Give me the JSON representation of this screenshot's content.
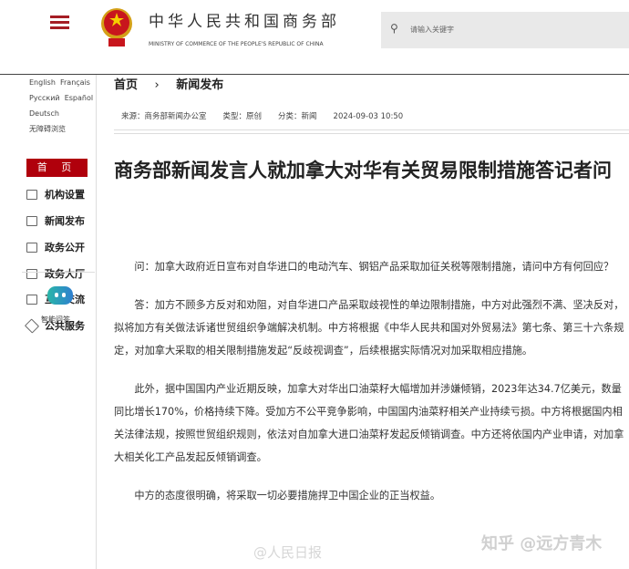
{
  "header": {
    "title_cn": "中华人民共和国商务部",
    "title_en": "MINISTRY OF COMMERCE OF THE PEOPLE'S REPUBLIC OF CHINA",
    "search_placeholder": "请输入关键字"
  },
  "sidebar": {
    "languages": [
      "English",
      "Français",
      "Русский",
      "Español",
      "Deutsch",
      "无障碍浏览"
    ],
    "home": "首 页",
    "items": [
      "机构设置",
      "新闻发布",
      "政务公开",
      "政务大厅",
      "互动交流",
      "公共服务"
    ],
    "assistant": "智能问答"
  },
  "breadcrumb": {
    "home": "首页",
    "sep": "›",
    "current": "新闻发布"
  },
  "meta": {
    "source": "来源：商务部新闻办公室",
    "type": "类型：原创",
    "category": "分类：新闻",
    "datetime": "2024-09-03 10:50"
  },
  "article": {
    "title": "商务部新闻发言人就加拿大对华有关贸易限制措施答记者问",
    "paragraphs": [
      "问：加拿大政府近日宣布对自华进口的电动汽车、钢铝产品采取加征关税等限制措施，请问中方有何回应？",
      "答：加方不顾多方反对和劝阻，对自华进口产品采取歧视性的单边限制措施，中方对此强烈不满、坚决反对，拟将加方有关做法诉诸世贸组织争端解决机制。中方将根据《中华人民共和国对外贸易法》第七条、第三十六条规定，对加拿大采取的相关限制措施发起“反歧视调查”，后续根据实际情况对加采取相应措施。",
      "此外，据中国国内产业近期反映，加拿大对华出口油菜籽大幅增加并涉嫌倾销，2023年达34.7亿美元，数量同比增长170%，价格持续下降。受加方不公平竞争影响，中国国内油菜籽相关产业持续亏损。中方将根据国内相关法律法规，按照世贸组织规则，依法对自加拿大进口油菜籽发起反倾销调查。中方还将依国内产业申请，对加拿大相关化工产品发起反倾销调查。",
      "中方的态度很明确，将采取一切必要措施捍卫中国企业的正当权益。"
    ]
  },
  "watermarks": {
    "zhihu": "知乎 @远方青木",
    "weibo": "@人民日报"
  }
}
